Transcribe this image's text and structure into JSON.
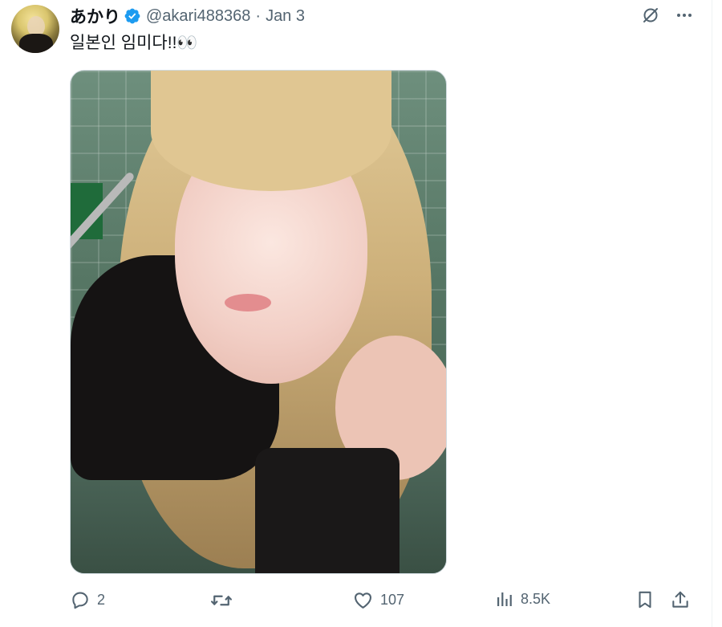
{
  "user": {
    "display_name": "あかり",
    "handle": "@akari488368",
    "separator": "·",
    "date": "Jan 3",
    "verified": true
  },
  "tweet": {
    "text": "일본인 임미다!!👀"
  },
  "icons": {
    "grok": "grok-icon",
    "more": "more-icon",
    "reply": "reply-icon",
    "retweet": "retweet-icon",
    "like": "heart-icon",
    "views": "views-icon",
    "bookmark": "bookmark-icon",
    "share": "share-icon",
    "verified": "verified-badge-icon"
  },
  "stats": {
    "replies": "2",
    "retweets": "",
    "likes": "107",
    "views": "8.5K"
  },
  "colors": {
    "text": "#0f1419",
    "secondary": "#536471",
    "verified": "#1d9bf0",
    "border": "#cfd9de"
  }
}
